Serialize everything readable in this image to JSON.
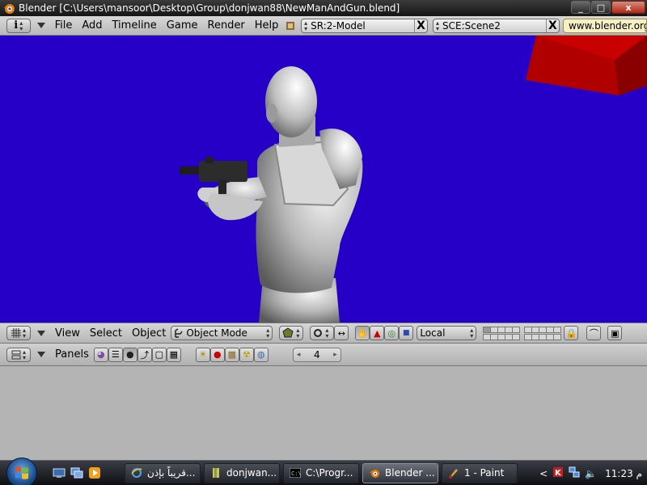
{
  "window": {
    "title": "Blender [C:\\Users\\mansoor\\Desktop\\Group\\donjwan88\\NewManAndGun.blend]",
    "minimize_label": "_",
    "maximize_label": "□",
    "close_label": "x"
  },
  "info_header": {
    "window_type_label": "i",
    "menus": [
      "File",
      "Add",
      "Timeline",
      "Game",
      "Render",
      "Help"
    ],
    "screen_field": "SR:2-Model",
    "scene_field": "SCE:Scene2",
    "delete_label": "X",
    "url": "www.blender.org"
  },
  "view3d_header": {
    "menus": [
      "View",
      "Select",
      "Object"
    ],
    "mode": "Object Mode",
    "orientation": "Local"
  },
  "buttons_header": {
    "panels_label": "Panels",
    "frame_number": "4",
    "prev_arrow": "◂",
    "next_arrow": "▸"
  },
  "taskbar": {
    "tasks": [
      {
        "label": "قريباً بإذن...",
        "icon": "internet-explorer-icon"
      },
      {
        "label": "donjwan...",
        "icon": "folder-icon"
      },
      {
        "label": "C:\\Progr...",
        "icon": "command-prompt-icon"
      },
      {
        "label": "Blender ...",
        "icon": "blender-icon"
      },
      {
        "label": "1 - Paint",
        "icon": "paint-icon"
      }
    ],
    "tray_chevron": "<",
    "clock": "11:23 م"
  },
  "colors": {
    "viewport_bg": "#2700c8",
    "cube": "#c80000",
    "header": "#c8c8c8"
  }
}
